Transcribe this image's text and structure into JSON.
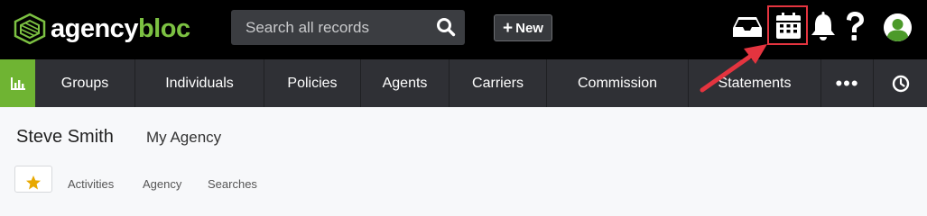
{
  "header": {
    "logo": {
      "text_white": "agency",
      "text_green": "bloc",
      "brand_green": "#7cc142"
    },
    "search": {
      "placeholder": "Search all records",
      "icon": "search-icon"
    },
    "new_button": {
      "plus": "+",
      "label": "New"
    },
    "icons": [
      "inbox-icon",
      "calendar-icon",
      "bell-icon",
      "help-icon",
      "avatar"
    ],
    "highlight_color": "#e4343f"
  },
  "nav": {
    "dashboard_icon": "bar-chart-icon",
    "items": [
      {
        "label": "Groups"
      },
      {
        "label": "Individuals"
      },
      {
        "label": "Policies"
      },
      {
        "label": "Agents"
      },
      {
        "label": "Carriers"
      },
      {
        "label": "Commission"
      },
      {
        "label": "Statements"
      }
    ],
    "more_label": "•••",
    "history_icon": "clock-icon",
    "accent_color": "#6fb433"
  },
  "record": {
    "name": "Steve Smith",
    "agency": "My Agency"
  },
  "tabs": [
    {
      "label": "Activities"
    },
    {
      "label": "Agency"
    },
    {
      "label": "Searches"
    }
  ]
}
